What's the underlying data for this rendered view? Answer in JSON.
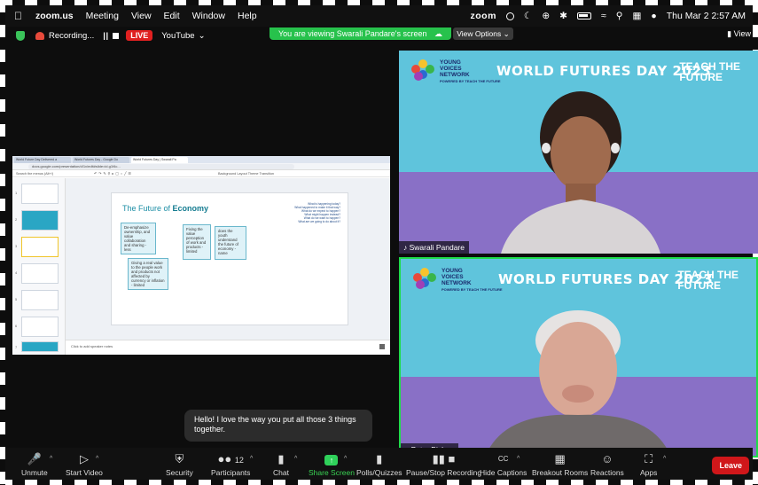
{
  "menubar": {
    "app": "zoom.us",
    "items": [
      "Meeting",
      "View",
      "Edit",
      "Window",
      "Help"
    ],
    "zoom_logo": "zoom",
    "datetime": "Thu Mar 2  2:57 AM"
  },
  "status": {
    "recording": "Recording...",
    "live": "LIVE",
    "youtube": "YouTube",
    "viewing": "You are viewing Swarali Pandare's screen",
    "view_options": "View Options",
    "view": "View"
  },
  "shared": {
    "tabs": [
      "World Future Day Delivered a",
      "World Futures Day - Google Do",
      "World Futures Day | Swarali Pa"
    ],
    "url": "docs.google.com/presentation/d/1x/edit#slide=id.g1f4c...",
    "search": "Search the menus (Alt+/)",
    "toolbar_items": "Background  Layout  Theme  Transition",
    "slide_title_plain": "The Future of ",
    "slide_title_bold": "Economy",
    "questions": [
      "What is happening today?",
      "What happened to make it that way?",
      "What do we expect to happen?",
      "What might happen instead?",
      "What do we want to happen?",
      "What are we going to do about it?"
    ],
    "notes": [
      "De-emphasize ownership, and value collaboration and sharing - less",
      "Fixing the value perception of work and products - limited",
      "does the youth understand the future of economy - name",
      "Giving a real value to the people work and products not affected by currency or inflation - limited"
    ],
    "speaker_notes": "Click to add speaker notes",
    "thumb_numbers": [
      "1",
      "2",
      "3",
      "4",
      "5",
      "6",
      "7"
    ]
  },
  "tiles": [
    {
      "name": "Swarali Pandare",
      "logo_line1": "YOUNG",
      "logo_line2": "VOICES",
      "logo_line3": "NETWORK",
      "logo_small": "POWERED BY TEACH THE FUTURE",
      "event": "WORLD FUTURES DAY 2023",
      "ttf1": "TEACH THE",
      "ttf2": "FUTURE"
    },
    {
      "name": "Peter Bishop",
      "logo_line1": "YOUNG",
      "logo_line2": "VOICES",
      "logo_line3": "NETWORK",
      "logo_small": "POWERED BY TEACH THE FUTURE",
      "event": "WORLD FUTURES DAY 2023",
      "ttf1": "TEACH THE",
      "ttf2": "FUTURE"
    }
  ],
  "chat_toast": "Hello! I love the way you put all those 3 things together.",
  "toolbar": {
    "unmute": "Unmute",
    "start_video": "Start Video",
    "security": "Security",
    "participants": "Participants",
    "participants_count": "12",
    "chat": "Chat",
    "share_screen": "Share Screen",
    "polls": "Polls/Quizzes",
    "pause_recording": "Pause/Stop Recording",
    "hide_captions": "Hide Captions",
    "breakout": "Breakout Rooms",
    "reactions": "Reactions",
    "apps": "Apps",
    "leave": "Leave"
  },
  "colors": {
    "share_green": "#27c24c",
    "live_red": "#e02020",
    "tile_cyan": "#5fc4dc",
    "tile_purple": "#8970c6",
    "active_speaker": "#1fdc4a",
    "leave_red": "#d0171a"
  }
}
